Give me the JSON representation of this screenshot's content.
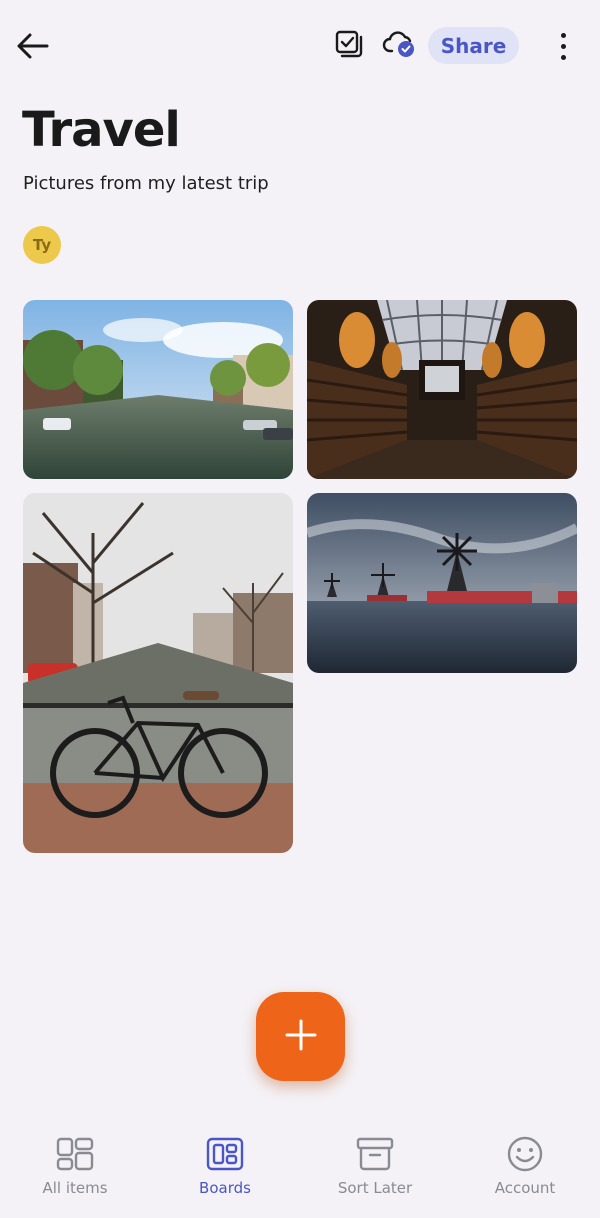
{
  "header": {
    "back_icon": "arrow-left-icon",
    "select_icon": "select-checkbox-icon",
    "sync_icon": "cloud-check-icon",
    "share_label": "Share",
    "more_icon": "more-vertical-icon"
  },
  "board": {
    "title": "Travel",
    "description": "Pictures from my latest trip",
    "member_initials": "Ty"
  },
  "photos": [
    {
      "subject": "canal-street"
    },
    {
      "subject": "library-hall"
    },
    {
      "subject": "bicycle-bridge"
    },
    {
      "subject": "windmills-water"
    }
  ],
  "fab": {
    "icon": "plus-icon"
  },
  "bottom_nav": [
    {
      "label": "All items",
      "icon": "grid-icon",
      "active": false
    },
    {
      "label": "Boards",
      "icon": "boards-icon",
      "active": true
    },
    {
      "label": "Sort Later",
      "icon": "archive-box-icon",
      "active": false
    },
    {
      "label": "Account",
      "icon": "smiley-icon",
      "active": false
    }
  ],
  "colors": {
    "background": "#f4f2f6",
    "accent": "#4a56c8",
    "share_bg": "#dfe3f5",
    "fab": "#ee6418",
    "avatar": "#edc94b",
    "nav_inactive": "#8a8a92"
  }
}
